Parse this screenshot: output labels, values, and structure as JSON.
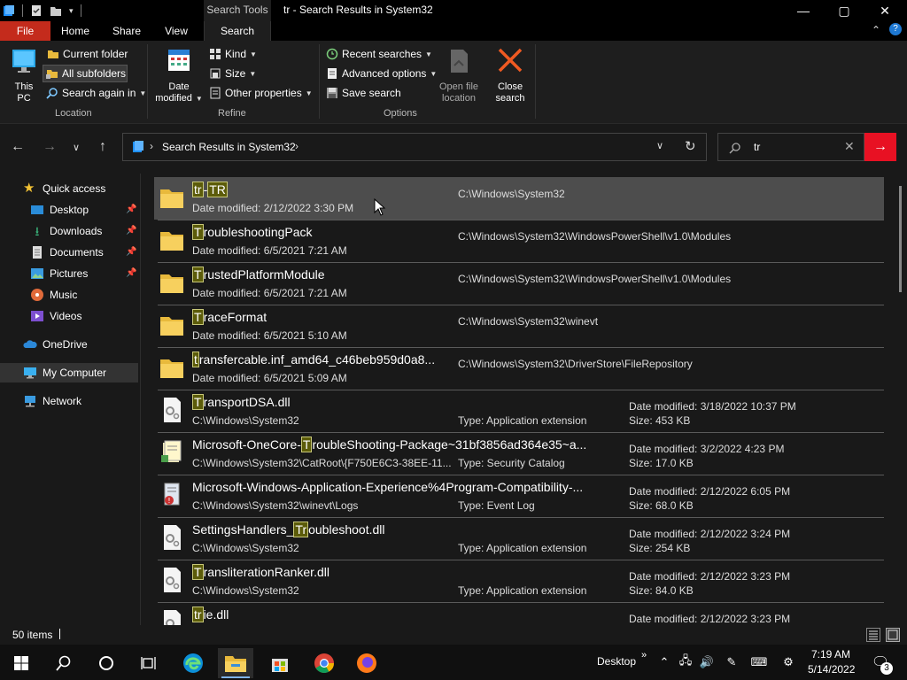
{
  "titlebar": {
    "context_tab": "Search Tools",
    "title": "tr - Search Results in System32",
    "minimize": "—",
    "maximize": "▢",
    "close": "✕"
  },
  "ribbon_tabs": {
    "file": "File",
    "home": "Home",
    "share": "Share",
    "view": "View",
    "search": "Search"
  },
  "ribbon": {
    "location": {
      "this_pc": "This PC",
      "current_folder": "Current folder",
      "all_subfolders": "All subfolders",
      "search_again": "Search again in",
      "label": "Location"
    },
    "refine": {
      "date_modified_line1": "Date",
      "date_modified_line2": "modified",
      "kind": "Kind",
      "size": "Size",
      "other_properties": "Other properties",
      "label": "Refine"
    },
    "options": {
      "recent_searches": "Recent searches",
      "advanced_options": "Advanced options",
      "save_search": "Save search",
      "open_file_location_line1": "Open file",
      "open_file_location_line2": "location",
      "close_search_line1": "Close",
      "close_search_line2": "search",
      "label": "Options"
    }
  },
  "address": {
    "path": "Search Results in System32",
    "search_value": "tr"
  },
  "nav": {
    "quick_access": "Quick access",
    "desktop": "Desktop",
    "downloads": "Downloads",
    "documents": "Documents",
    "pictures": "Pictures",
    "music": "Music",
    "videos": "Videos",
    "onedrive": "OneDrive",
    "my_computer": "My Computer",
    "network": "Network"
  },
  "files": [
    {
      "pre": "",
      "hl": "tr",
      "mid": "-",
      "hl2": "TR",
      "post": "",
      "sub": "Date modified: 2/12/2022 3:30 PM",
      "path": "C:\\Windows\\System32",
      "type": "",
      "dm": "",
      "sz": ""
    },
    {
      "pre": "",
      "hl": "T",
      "post": "roubleshootingPack",
      "sub": "Date modified: 6/5/2021 7:21 AM",
      "path": "C:\\Windows\\System32\\WindowsPowerShell\\v1.0\\Modules",
      "type": "",
      "dm": "",
      "sz": ""
    },
    {
      "pre": "",
      "hl": "T",
      "post": "rustedPlatformModule",
      "sub": "Date modified: 6/5/2021 7:21 AM",
      "path": "C:\\Windows\\System32\\WindowsPowerShell\\v1.0\\Modules",
      "type": "",
      "dm": "",
      "sz": ""
    },
    {
      "pre": "",
      "hl": "T",
      "post": "raceFormat",
      "sub": "Date modified: 6/5/2021 5:10 AM",
      "path": "C:\\Windows\\System32\\winevt",
      "type": "",
      "dm": "",
      "sz": ""
    },
    {
      "pre": "",
      "hl": "t",
      "post": "ransfercable.inf_amd64_c46beb959d0a8...",
      "sub": "Date modified: 6/5/2021 5:09 AM",
      "path": "C:\\Windows\\System32\\DriverStore\\FileRepository",
      "type": "",
      "dm": "",
      "sz": ""
    },
    {
      "pre": "",
      "hl": "T",
      "post": "ransportDSA.dll",
      "sub": "C:\\Windows\\System32",
      "path": "",
      "type": "Type: Application extension",
      "dm": "Date modified: 3/18/2022 10:37 PM",
      "sz": "Size: 453 KB"
    },
    {
      "pre": "Microsoft-OneCore-",
      "hl": "T",
      "post": "roubleShooting-Package~31bf3856ad364e35~a...",
      "sub": "C:\\Windows\\System32\\CatRoot\\{F750E6C3-38EE-11...",
      "path": "",
      "type": "Type: Security Catalog",
      "dm": "Date modified: 3/2/2022 4:23 PM",
      "sz": "Size: 17.0 KB"
    },
    {
      "pre": "Microsoft-Windows-Application-Experience%4Program-Compatibility-...",
      "hl": "",
      "post": "",
      "sub": "C:\\Windows\\System32\\winevt\\Logs",
      "path": "",
      "type": "Type: Event Log",
      "dm": "Date modified: 2/12/2022 6:05 PM",
      "sz": "Size: 68.0 KB"
    },
    {
      "pre": "SettingsHandlers_",
      "hl": "Tr",
      "post": "oubleshoot.dll",
      "sub": "C:\\Windows\\System32",
      "path": "",
      "type": "Type: Application extension",
      "dm": "Date modified: 2/12/2022 3:24 PM",
      "sz": "Size: 254 KB"
    },
    {
      "pre": "",
      "hl": "T",
      "post": "ransliterationRanker.dll",
      "sub": "C:\\Windows\\System32",
      "path": "",
      "type": "Type: Application extension",
      "dm": "Date modified: 2/12/2022 3:23 PM",
      "sz": "Size: 84.0 KB"
    },
    {
      "pre": "",
      "hl": "tr",
      "post": "ie.dll",
      "sub": "",
      "path": "",
      "type": "",
      "dm": "Date modified: 2/12/2022 3:23 PM",
      "sz": ""
    }
  ],
  "status": {
    "items": "50 items"
  },
  "taskbar": {
    "desktop_label": "Desktop",
    "time": "7:19 AM",
    "date": "5/14/2022",
    "notifications": "3"
  },
  "colors": {
    "accent_red": "#e81123",
    "file_tab": "#c42b1c",
    "highlight": "#5c5c0a"
  }
}
